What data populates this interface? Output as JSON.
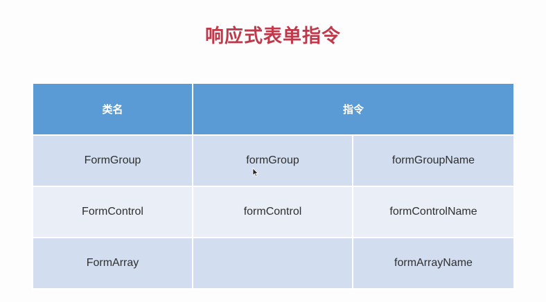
{
  "title": "响应式表单指令",
  "table": {
    "headers": {
      "class_name": "类名",
      "directive": "指令"
    },
    "rows": [
      {
        "class_name": "FormGroup",
        "directive": "formGroup",
        "name_directive": "formGroupName"
      },
      {
        "class_name": "FormControl",
        "directive": "formControl",
        "name_directive": "formControlName"
      },
      {
        "class_name": "FormArray",
        "directive": "",
        "name_directive": "formArrayName"
      }
    ]
  },
  "colors": {
    "title": "#c0394a",
    "header_bg": "#5b9bd5",
    "row_odd_bg": "#d2deef",
    "row_even_bg": "#e9eef7"
  }
}
